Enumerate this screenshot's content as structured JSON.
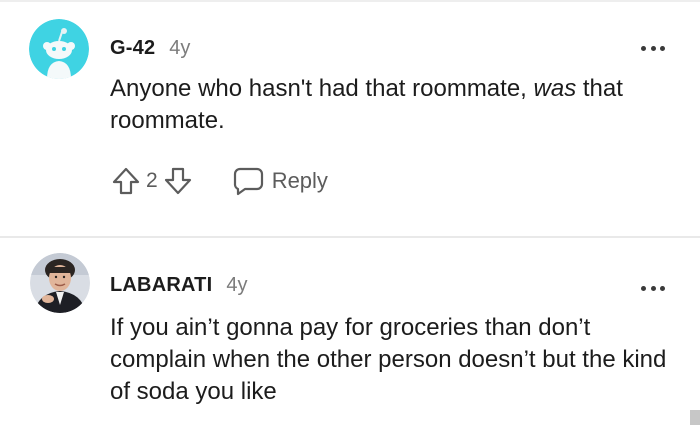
{
  "comments": [
    {
      "username": "G-42",
      "age": "4y",
      "body_plain": "Anyone who hasn't had that roommate, ",
      "body_emph": "was",
      "body_tail": " that roommate.",
      "score": "2",
      "reply_label": "Reply",
      "avatar_icon": "snoo-avatar-icon",
      "avatar_color": "#3fd3e3"
    },
    {
      "username": "LABARATI",
      "age": "4y",
      "body_plain": "If you ain’t gonna pay for groceries than don’t complain when the other person doesn’t but the kind of soda you like",
      "avatar_icon": "user-photo-avatar"
    }
  ],
  "colors": {
    "text": "#1c1c1c",
    "meta": "#7c7c7c",
    "action": "#5c5c5c",
    "divider": "#e9e9e9"
  }
}
